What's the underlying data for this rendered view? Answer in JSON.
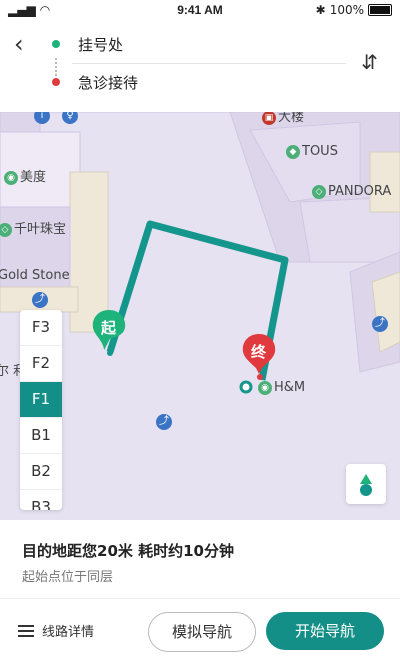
{
  "status_bar": {
    "time": "9:41 AM",
    "battery": "100%"
  },
  "header": {
    "origin": "挂号处",
    "destination": "急诊接待",
    "colors": {
      "origin_dot": "#1db37a",
      "destination_dot": "#e0393e"
    }
  },
  "map": {
    "labels": {
      "dept_store": "大楼",
      "tous": "TOUS",
      "pandora": "PANDORA",
      "meidu": "美度",
      "qianye": "千叶珠宝",
      "gold_stone": "Gold Stone",
      "partial_left": "尔 利",
      "hm": "H&M"
    },
    "start_pin": "起",
    "end_pin": "终",
    "route_color": "#15968c"
  },
  "floors": [
    {
      "label": "F3",
      "active": false
    },
    {
      "label": "F2",
      "active": false
    },
    {
      "label": "F1",
      "active": true
    },
    {
      "label": "B1",
      "active": false
    },
    {
      "label": "B2",
      "active": false
    },
    {
      "label": "B3",
      "active": false
    }
  ],
  "info": {
    "summary": "目的地距您20米   耗时约10分钟",
    "sub": "起始点位于同层"
  },
  "actions": {
    "details": "线路详情",
    "simulate": "模拟导航",
    "start": "开始导航"
  },
  "accent": "#148f87"
}
